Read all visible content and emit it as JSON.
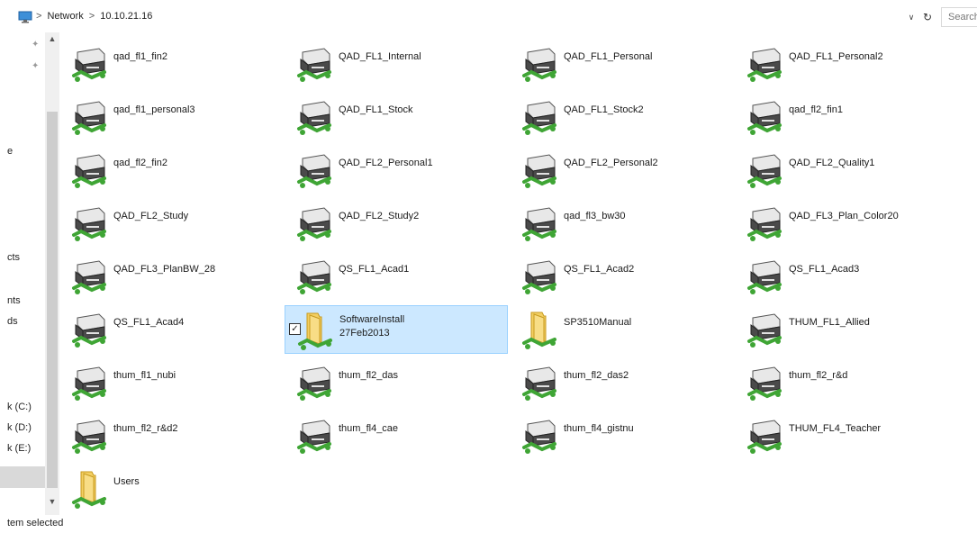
{
  "address": {
    "breadcrumbs": [
      "Network",
      "10.10.21.16"
    ],
    "separator": ">",
    "dropdown_glyph": "∨",
    "refresh_glyph": "↻",
    "search_placeholder": "Search"
  },
  "nav": {
    "items": [
      "e",
      "cts",
      "nts",
      "ds",
      "k (C:)",
      "k (D:)",
      "k (E:)"
    ],
    "pin_glyph": "📌"
  },
  "items": [
    {
      "label": "qad_fl1_fin2",
      "type": "printer"
    },
    {
      "label": "QAD_FL1_Internal",
      "type": "printer"
    },
    {
      "label": "QAD_FL1_Personal",
      "type": "printer"
    },
    {
      "label": "QAD_FL1_Personal2",
      "type": "printer"
    },
    {
      "label": "qad_fl1_personal3",
      "type": "printer"
    },
    {
      "label": "QAD_FL1_Stock",
      "type": "printer"
    },
    {
      "label": "QAD_FL1_Stock2",
      "type": "printer"
    },
    {
      "label": "qad_fl2_fin1",
      "type": "printer"
    },
    {
      "label": "qad_fl2_fin2",
      "type": "printer"
    },
    {
      "label": "QAD_FL2_Personal1",
      "type": "printer"
    },
    {
      "label": "QAD_FL2_Personal2",
      "type": "printer"
    },
    {
      "label": "QAD_FL2_Quality1",
      "type": "printer"
    },
    {
      "label": "QAD_FL2_Study",
      "type": "printer"
    },
    {
      "label": "QAD_FL2_Study2",
      "type": "printer"
    },
    {
      "label": "qad_fl3_bw30",
      "type": "printer"
    },
    {
      "label": "QAD_FL3_Plan_Color20",
      "type": "printer"
    },
    {
      "label": "QAD_FL3_PlanBW_28",
      "type": "printer"
    },
    {
      "label": "QS_FL1_Acad1",
      "type": "printer"
    },
    {
      "label": "QS_FL1_Acad2",
      "type": "printer"
    },
    {
      "label": "QS_FL1_Acad3",
      "type": "printer"
    },
    {
      "label": "QS_FL1_Acad4",
      "type": "printer"
    },
    {
      "label": "SoftwareInstall 27Feb2013",
      "type": "share",
      "selected": true
    },
    {
      "label": "SP3510Manual",
      "type": "share"
    },
    {
      "label": "THUM_FL1_Allied",
      "type": "printer"
    },
    {
      "label": "thum_fl1_nubi",
      "type": "printer"
    },
    {
      "label": "thum_fl2_das",
      "type": "printer"
    },
    {
      "label": "thum_fl2_das2",
      "type": "printer"
    },
    {
      "label": "thum_fl2_r&d",
      "type": "printer"
    },
    {
      "label": "thum_fl2_r&d2",
      "type": "printer"
    },
    {
      "label": "thum_fl4_cae",
      "type": "printer"
    },
    {
      "label": "thum_fl4_gistnu",
      "type": "printer"
    },
    {
      "label": "THUM_FL4_Teacher",
      "type": "printer"
    },
    {
      "label": "Users",
      "type": "share"
    }
  ],
  "status": {
    "text": "tem selected"
  },
  "colors": {
    "selection_bg": "#cce8ff",
    "selection_border": "#99d1ff",
    "network_green": "#3fa535",
    "folder_yellow": "#f3cf63"
  }
}
